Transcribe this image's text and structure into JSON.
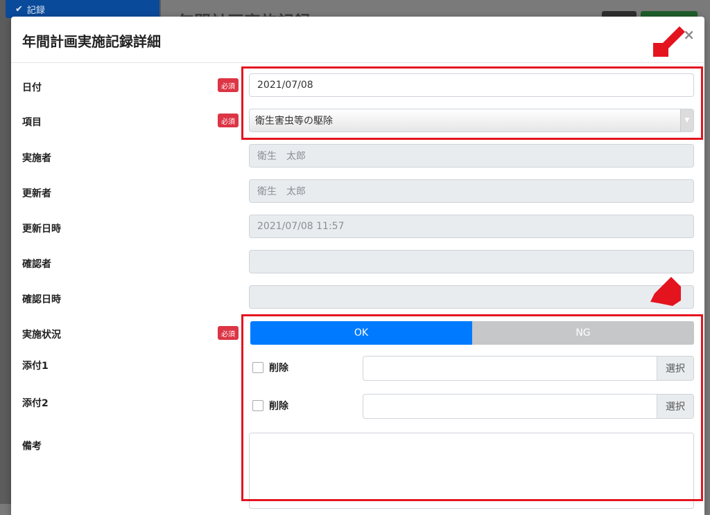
{
  "background": {
    "nav_item": "記録",
    "page_title": "年間計画実施記録"
  },
  "modal": {
    "title": "年間計画実施記録詳細",
    "close": "×"
  },
  "required_badge": "必須",
  "fields": {
    "date": {
      "label": "日付",
      "value": "2021/07/08"
    },
    "item": {
      "label": "項目",
      "value": "衛生害虫等の駆除"
    },
    "implementer": {
      "label": "実施者",
      "value": "衛生　太郎"
    },
    "updater": {
      "label": "更新者",
      "value": "衛生　太郎"
    },
    "updated_at": {
      "label": "更新日時",
      "value": "2021/07/08 11:57"
    },
    "confirmer": {
      "label": "確認者",
      "value": ""
    },
    "confirmed_at": {
      "label": "確認日時",
      "value": ""
    },
    "status": {
      "label": "実施状況",
      "ok": "OK",
      "ng": "NG",
      "selected": "OK"
    },
    "attachment1": {
      "label": "添付1",
      "delete_label": "削除",
      "select_label": "選択",
      "value": ""
    },
    "attachment2": {
      "label": "添付2",
      "delete_label": "削除",
      "select_label": "選択",
      "value": ""
    },
    "remarks": {
      "label": "備考",
      "value": ""
    }
  },
  "colors": {
    "primary": "#007bff",
    "required": "#dc3545",
    "annotation": "#e4141f"
  }
}
